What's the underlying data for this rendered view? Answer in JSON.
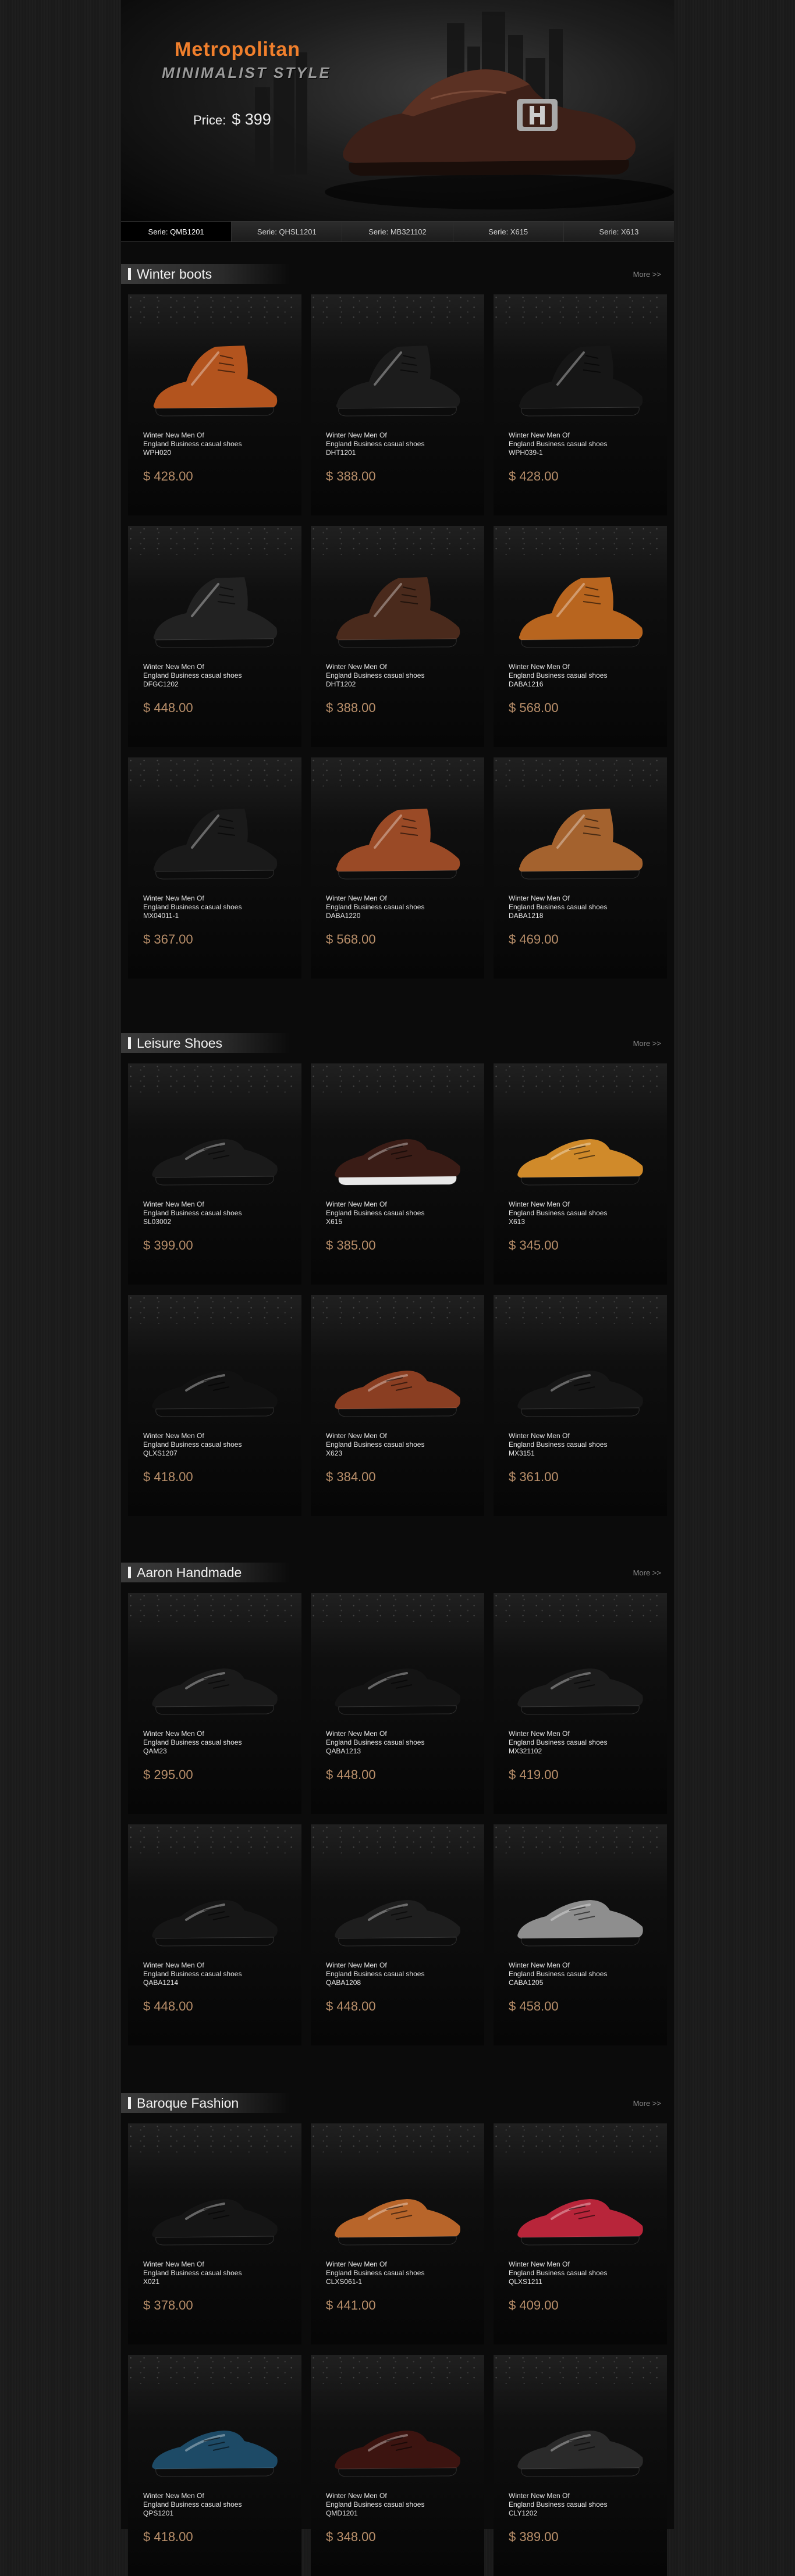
{
  "hero": {
    "title": "Metropolitan",
    "subtitle": "MINIMALIST STYLE",
    "price_label": "Price:",
    "price": "$ 399"
  },
  "series_tabs": [
    {
      "label": "Serie:  QMB1201",
      "active": true
    },
    {
      "label": "Serie:  QHSL1201",
      "active": false
    },
    {
      "label": "Serie:  MB321102",
      "active": false
    },
    {
      "label": "Serie:  X615",
      "active": false
    },
    {
      "label": "Serie:  X613",
      "active": false
    }
  ],
  "sections": [
    {
      "title": "Winter boots",
      "more": "More >>",
      "products": [
        {
          "name": "Winter New Men Of\nEngland Business casual shoes",
          "code": "WPH020",
          "price": "$ 428.00",
          "color": "#b3541e",
          "style": "boot"
        },
        {
          "name": "Winter New Men Of\nEngland Business casual shoes",
          "code": "DHT1201",
          "price": "$ 388.00",
          "color": "#1c1c1c",
          "style": "boot"
        },
        {
          "name": "Winter New Men Of\nEngland Business casual shoes",
          "code": "WPH039-1",
          "price": "$ 428.00",
          "color": "#161616",
          "style": "boot"
        },
        {
          "name": "Winter New Men Of\nEngland Business casual shoes",
          "code": "DFGC1202",
          "price": "$ 448.00",
          "color": "#222",
          "style": "boot"
        },
        {
          "name": "Winter New Men Of\nEngland Business casual shoes",
          "code": "DHT1202",
          "price": "$ 388.00",
          "color": "#4a2a1c",
          "style": "boot"
        },
        {
          "name": "Winter New Men Of\nEngland Business casual shoes",
          "code": "DABA1216",
          "price": "$ 568.00",
          "color": "#b8651f",
          "style": "boot"
        },
        {
          "name": "Winter New Men Of\nEngland Business casual shoes",
          "code": "MX04011-1",
          "price": "$ 367.00",
          "color": "#1a1a1a",
          "style": "boot"
        },
        {
          "name": "Winter New Men Of\nEngland Business casual shoes",
          "code": "DABA1220",
          "price": "$ 568.00",
          "color": "#9a4a26",
          "style": "boot"
        },
        {
          "name": "Winter New Men Of\nEngland Business casual shoes",
          "code": "DABA1218",
          "price": "$ 469.00",
          "color": "#a4622e",
          "style": "boot"
        }
      ]
    },
    {
      "title": "Leisure Shoes",
      "more": "More >>",
      "products": [
        {
          "name": "Winter New Men Of\nEngland Business casual shoes",
          "code": "SL03002",
          "price": "$ 399.00",
          "color": "#1a1a1a",
          "style": "low"
        },
        {
          "name": "Winter New Men Of\nEngland Business casual shoes",
          "code": "X615",
          "price": "$ 385.00",
          "color": "#3a1c16",
          "style": "sneaker"
        },
        {
          "name": "Winter New Men Of\nEngland Business casual shoes",
          "code": "X613",
          "price": "$ 345.00",
          "color": "#d08a2a",
          "style": "low"
        },
        {
          "name": "Winter New Men Of\nEngland Business casual shoes",
          "code": "QLXS1207",
          "price": "$ 418.00",
          "color": "#111",
          "style": "low"
        },
        {
          "name": "Winter New Men Of\nEngland Business casual shoes",
          "code": "X623",
          "price": "$ 384.00",
          "color": "#8a3e22",
          "style": "low"
        },
        {
          "name": "Winter New Men Of\nEngland Business casual shoes",
          "code": "MX3151",
          "price": "$ 361.00",
          "color": "#161616",
          "style": "low"
        }
      ]
    },
    {
      "title": "Aaron Handmade",
      "more": "More >>",
      "products": [
        {
          "name": "Winter New Men Of\nEngland Business casual shoes",
          "code": "QAM23",
          "price": "$ 295.00",
          "color": "#1a1a1a",
          "style": "low"
        },
        {
          "name": "Winter New Men Of\nEngland Business casual shoes",
          "code": "QABA1213",
          "price": "$ 448.00",
          "color": "#141414",
          "style": "low"
        },
        {
          "name": "Winter New Men Of\nEngland Business casual shoes",
          "code": "MX321102",
          "price": "$ 419.00",
          "color": "#1c1c1c",
          "style": "low"
        },
        {
          "name": "Winter New Men Of\nEngland Business casual shoes",
          "code": "QABA1214",
          "price": "$ 448.00",
          "color": "#161616",
          "style": "low"
        },
        {
          "name": "Winter New Men Of\nEngland Business casual shoes",
          "code": "QABA1208",
          "price": "$ 448.00",
          "color": "#1e1e1e",
          "style": "low"
        },
        {
          "name": "Winter New Men Of\nEngland Business casual shoes",
          "code": "CABA1205",
          "price": "$ 458.00",
          "color": "#8e8e8e",
          "style": "low"
        }
      ]
    },
    {
      "title": "Baroque Fashion",
      "more": "More >>",
      "products": [
        {
          "name": "Winter New Men Of\nEngland Business casual shoes",
          "code": "X021",
          "price": "$ 378.00",
          "color": "#151515",
          "style": "low"
        },
        {
          "name": "Winter New Men Of\nEngland Business casual shoes",
          "code": "CLXS061-1",
          "price": "$ 441.00",
          "color": "#b8652a",
          "style": "low"
        },
        {
          "name": "Winter New Men Of\nEngland Business casual shoes",
          "code": "QLXS1211",
          "price": "$ 409.00",
          "color": "#b8253a",
          "style": "low"
        },
        {
          "name": "Winter New Men Of\nEngland Business casual shoes",
          "code": "QPS1201",
          "price": "$ 418.00",
          "color": "#1d4a66",
          "style": "low"
        },
        {
          "name": "Winter New Men Of\nEngland Business casual shoes",
          "code": "QMD1201",
          "price": "$ 348.00",
          "color": "#3c1410",
          "style": "low"
        },
        {
          "name": "Winter New Men Of\nEngland Business casual shoes",
          "code": "CLY1202",
          "price": "$ 389.00",
          "color": "#2a2a2a",
          "style": "low"
        }
      ]
    }
  ]
}
